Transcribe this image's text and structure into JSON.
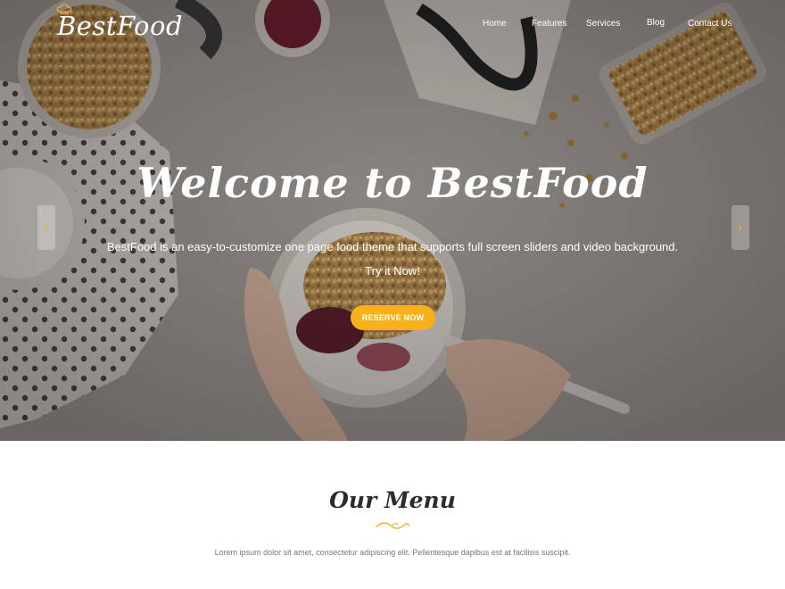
{
  "brand": {
    "logo_text": "BestFood",
    "accent_color": "#f6b11a"
  },
  "nav": {
    "items": [
      {
        "label": "Home"
      },
      {
        "label": "Features"
      },
      {
        "label": "Services"
      },
      {
        "label": "Blog"
      },
      {
        "label": "Contact Us"
      }
    ]
  },
  "hero": {
    "title": "Welcome to BestFood",
    "description": "BestFood is an easy-to-customize one page food theme that supports full screen sliders and video background.",
    "cta_text": "Try it Now!",
    "button_label": "RESERVE NOW",
    "prev_icon": "chevron-left-icon",
    "next_icon": "chevron-right-icon"
  },
  "menu_section": {
    "title": "Our Menu",
    "description": "Lorem ipsum dolor sit amet, consectetur adipiscing elit. Pellentesque dapibus est at facilisis suscipit."
  }
}
